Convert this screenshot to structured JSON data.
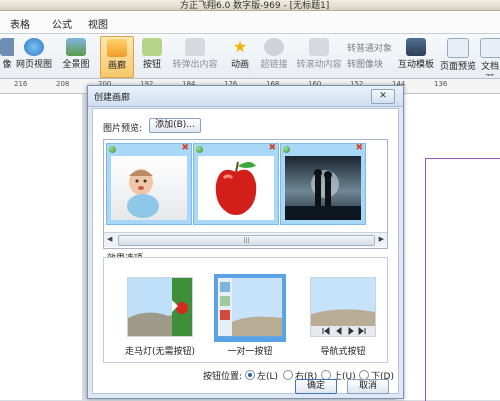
{
  "window": {
    "title": "方正飞翔6.0 数字版-969 - [无标题1]"
  },
  "menu": [
    "表格",
    "公式",
    "视图"
  ],
  "ribbon": {
    "btn_image": "像",
    "btn_webview": "网页视图",
    "btn_panorama": "全景图",
    "btn_gallery": "画廊",
    "btn_button": "按钮",
    "btn_popup": "转弹出内容",
    "btn_animation": "动画",
    "btn_hyperlink": "超链接",
    "btn_scroll": "转滚动内容",
    "btn_trigger": "转普通对象",
    "btn_imagefx": "转图像块",
    "btn_interactive": "互动模板",
    "btn_preview": "页面预览",
    "btn_docpreview": "文档预"
  },
  "ruler": [
    "216",
    "208",
    "200",
    "192",
    "184",
    "176",
    "168",
    "160",
    "152",
    "144",
    "136"
  ],
  "dialog": {
    "title": "创建画廊",
    "close_label": "✕",
    "pic_preview_label": "图片预览:",
    "add_button": "添加(B)...",
    "effects_label": "效果选项",
    "effects": [
      {
        "label": "走马灯(无需按钮)",
        "selected": false
      },
      {
        "label": "一对一按钮",
        "selected": true
      },
      {
        "label": "导航式按钮",
        "selected": false
      }
    ],
    "btn_position_label": "按钮位置:",
    "positions": [
      {
        "label": "左(L)",
        "checked": true
      },
      {
        "label": "右(R)",
        "checked": false
      },
      {
        "label": "上(U)",
        "checked": false
      },
      {
        "label": "下(D)",
        "checked": false
      }
    ],
    "ok": "确定",
    "cancel": "取消"
  },
  "colors": {
    "thumb_bg": "#a9d7f7",
    "selection": "#5aa2e6",
    "delete_x": "#d2452f",
    "accent_margin": "#9b59b6"
  },
  "icons": [
    "image-icon",
    "webview-icon",
    "panorama-icon",
    "gallery-icon",
    "button-icon",
    "popup-icon",
    "animation-icon",
    "hyperlink-icon",
    "scroll-icon",
    "interactive-icon",
    "preview-icon",
    "docpreview-icon"
  ]
}
